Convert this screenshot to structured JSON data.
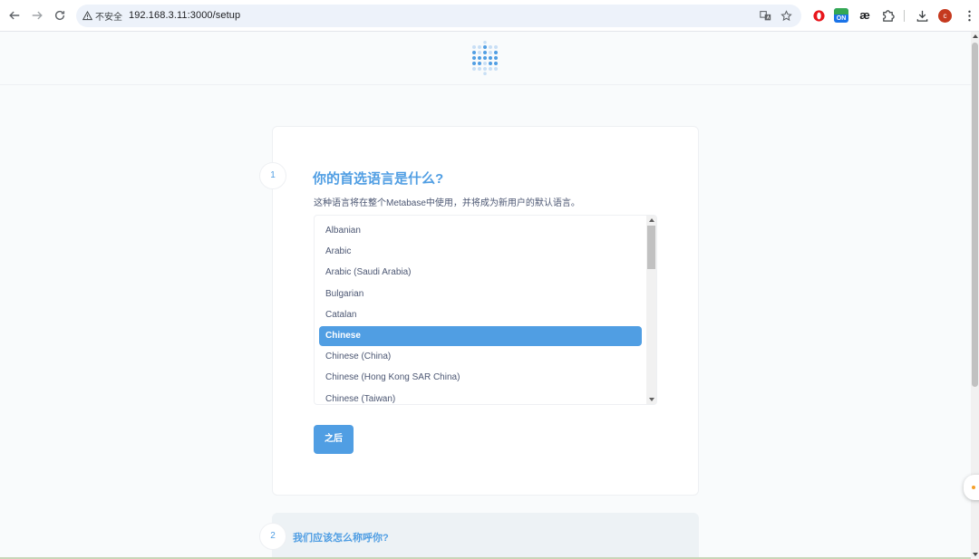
{
  "browser": {
    "security_label": "不安全",
    "url": "192.168.3.11:3000/setup",
    "extension_on_label": "ON",
    "extension_ae_label": "æ",
    "profile_initial": "c"
  },
  "colors": {
    "brand": "#509ee3",
    "text": "#4c5773",
    "background": "#f9fbfc"
  },
  "step1": {
    "number": "1",
    "title": "你的首选语言是什么?",
    "description": "这种语言将在整个Metabase中使用，并将成为新用户的默认语言。",
    "languages": [
      "Albanian",
      "Arabic",
      "Arabic (Saudi Arabia)",
      "Bulgarian",
      "Catalan",
      "Chinese",
      "Chinese (China)",
      "Chinese (Hong Kong SAR China)",
      "Chinese (Taiwan)"
    ],
    "selected_language": "Chinese",
    "next_label": "之后"
  },
  "step2": {
    "number": "2",
    "title": "我们应该怎么称呼你?"
  },
  "icons": {
    "back": "arrow-left-icon",
    "forward": "arrow-right-icon",
    "reload": "reload-icon",
    "warning": "warning-triangle-icon",
    "translate": "translate-icon",
    "bookmark": "star-icon",
    "opera": "opera-icon",
    "extensions": "puzzle-icon",
    "download": "download-icon",
    "menu": "kebab-menu-icon",
    "logo": "metabase-logo-icon"
  }
}
